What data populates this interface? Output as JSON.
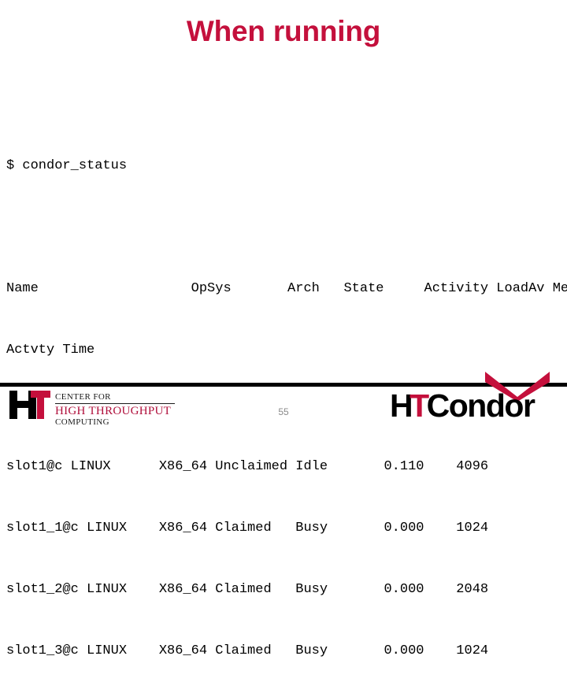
{
  "slide": {
    "title": "When running",
    "page_number": "55",
    "accent_color": "#c4103c",
    "background_color": "#ffffff"
  },
  "terminal": {
    "prompt_line": "$ condor_status",
    "header_line": "Name                   OpSys       Arch   State     Activity LoadAv Mem",
    "header_wrap_line": "Actvty Time",
    "rows": [
      "slot1@c LINUX      X86_64 Unclaimed Idle       0.110    4096",
      "slot1_1@c LINUX    X86_64 Claimed   Busy       0.000    1024",
      "slot1_2@c LINUX    X86_64 Claimed   Busy       0.000    2048",
      "slot1_3@c LINUX    X86_64 Claimed   Busy       0.000    1024"
    ],
    "columns": [
      "Name",
      "OpSys",
      "Arch",
      "State",
      "Activity",
      "LoadAv",
      "Mem"
    ],
    "machines": [
      {
        "name": "slot1@c",
        "opsys": "LINUX",
        "arch": "X86_64",
        "state": "Unclaimed",
        "activity": "Idle",
        "loadav": "0.110",
        "mem": "4096"
      },
      {
        "name": "slot1_1@c",
        "opsys": "LINUX",
        "arch": "X86_64",
        "state": "Claimed",
        "activity": "Busy",
        "loadav": "0.000",
        "mem": "1024"
      },
      {
        "name": "slot1_2@c",
        "opsys": "LINUX",
        "arch": "X86_64",
        "state": "Claimed",
        "activity": "Busy",
        "loadav": "0.000",
        "mem": "2048"
      },
      {
        "name": "slot1_3@c",
        "opsys": "LINUX",
        "arch": "X86_64",
        "state": "Claimed",
        "activity": "Busy",
        "loadav": "0.000",
        "mem": "1024"
      }
    ]
  },
  "chtc_logo": {
    "mark_h": "HT",
    "line1": "CENTER FOR",
    "line2": "HIGH THROUGHPUT",
    "line3": "COMPUTING"
  },
  "htcondor_logo": {
    "h": "H",
    "t": "T",
    "rest": "Condor"
  }
}
